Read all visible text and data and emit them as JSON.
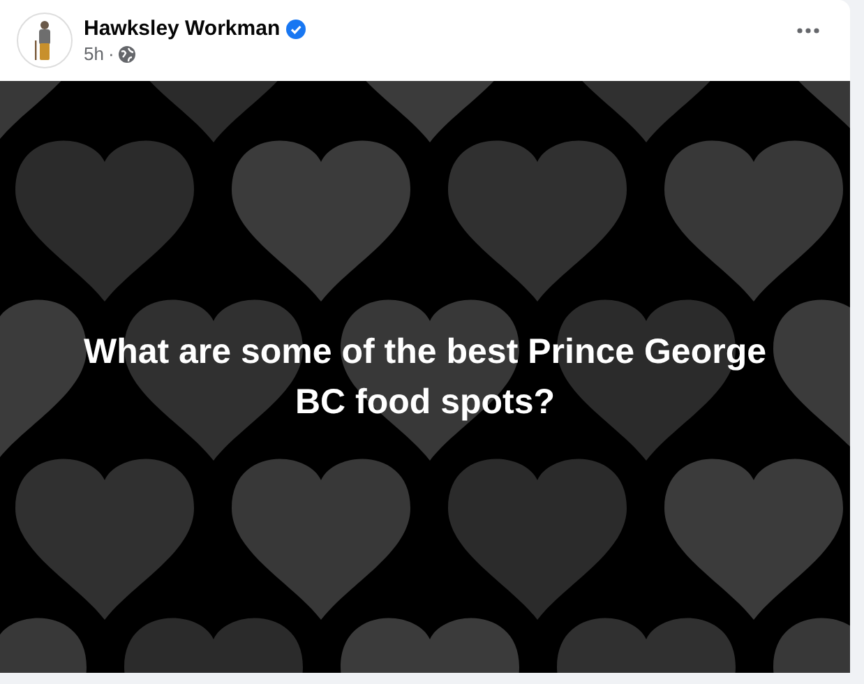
{
  "post": {
    "author": "Hawksley Workman",
    "verified": true,
    "time": "5h",
    "separator": "·",
    "text": "What are some of the best Prince George BC food spots?"
  }
}
